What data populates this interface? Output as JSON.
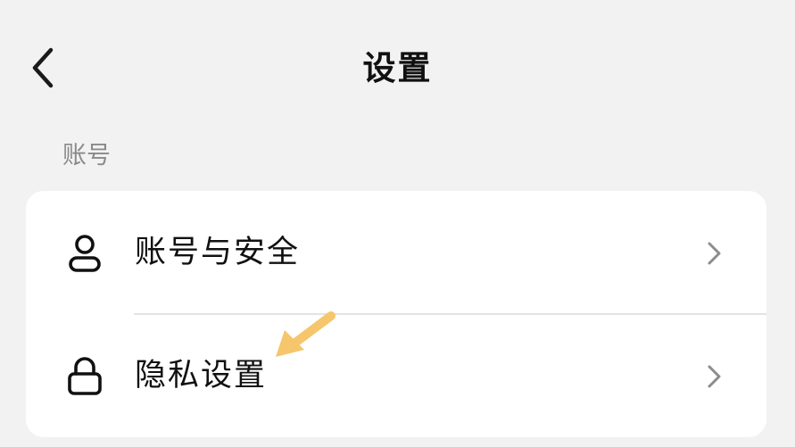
{
  "header": {
    "title": "设置"
  },
  "section": {
    "label": "账号"
  },
  "items": [
    {
      "label": "账号与安全",
      "icon": "user-icon"
    },
    {
      "label": "隐私设置",
      "icon": "lock-icon"
    }
  ],
  "colors": {
    "background": "#f2f2f2",
    "card": "#ffffff",
    "section_label": "#8a8a8a",
    "chevron": "#8c8c8c",
    "annotation_arrow": "#f5c66b"
  }
}
